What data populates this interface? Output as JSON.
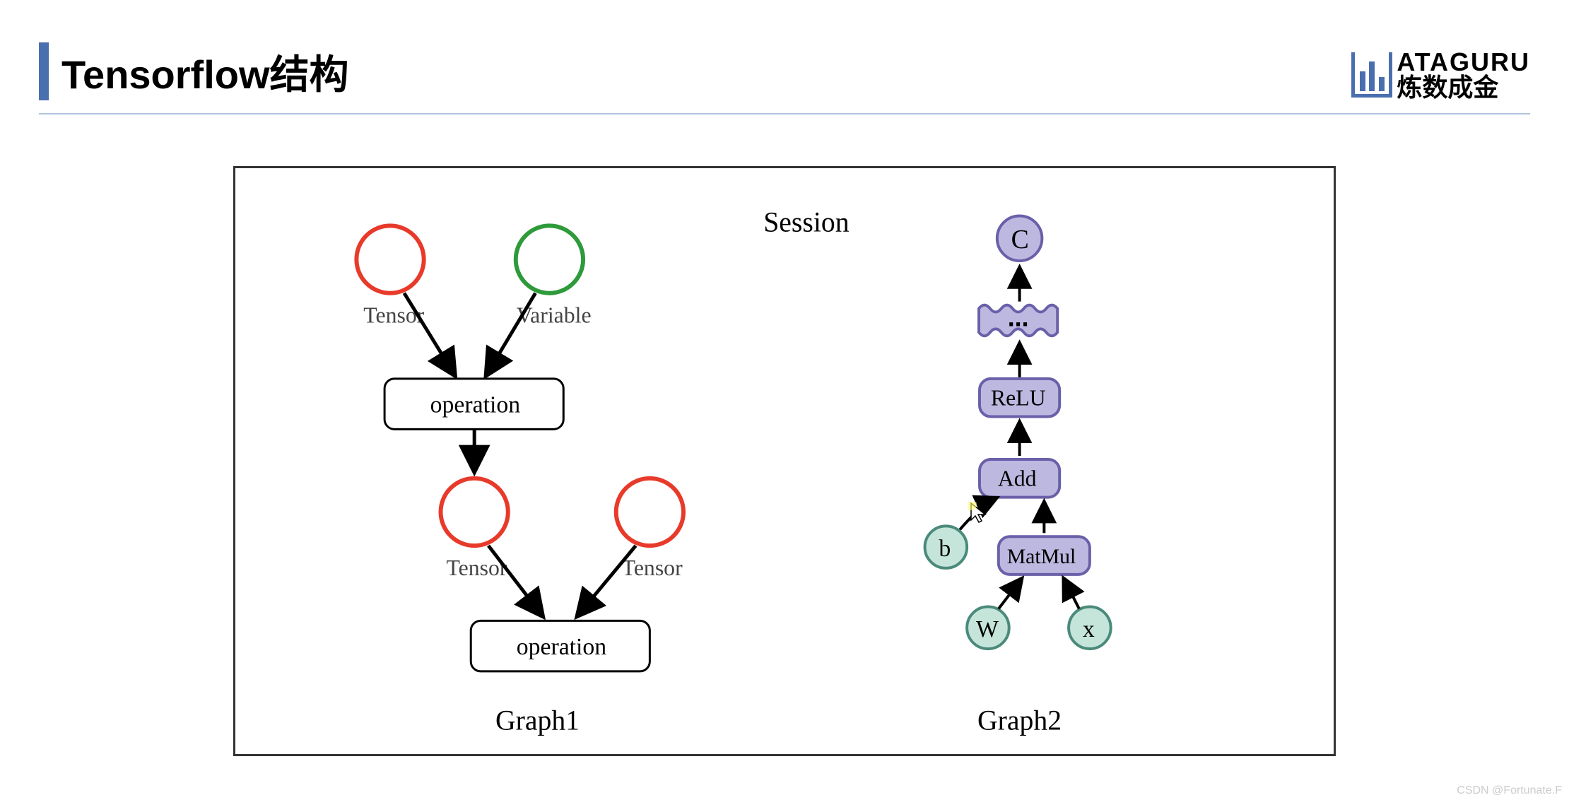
{
  "header": {
    "title": "Tensorflow结构",
    "logo_line1": "ATAGURU",
    "logo_line2": "炼数成金"
  },
  "diagram": {
    "session_label": "Session",
    "graph1": {
      "label": "Graph1",
      "tensor_label_a": "Tensor",
      "variable_label": "Variable",
      "operation_label_1": "operation",
      "tensor_label_b": "Tensor",
      "tensor_label_c": "Tensor",
      "operation_label_2": "operation"
    },
    "graph2": {
      "label": "Graph2",
      "node_c": "C",
      "node_dots": "...",
      "node_relu": "ReLU",
      "node_add": "Add",
      "node_matmul": "MatMul",
      "node_b": "b",
      "node_w": "W",
      "node_x": "x"
    }
  },
  "colors": {
    "red_circle": "#e83a2a",
    "green_circle": "#2e9a3a",
    "purple_fill": "#bcb8e0",
    "purple_stroke": "#6a60a9",
    "cyan_fill": "#c5e5db",
    "cyan_stroke": "#4a8a7a"
  },
  "watermark": "CSDN @Fortunate.F"
}
